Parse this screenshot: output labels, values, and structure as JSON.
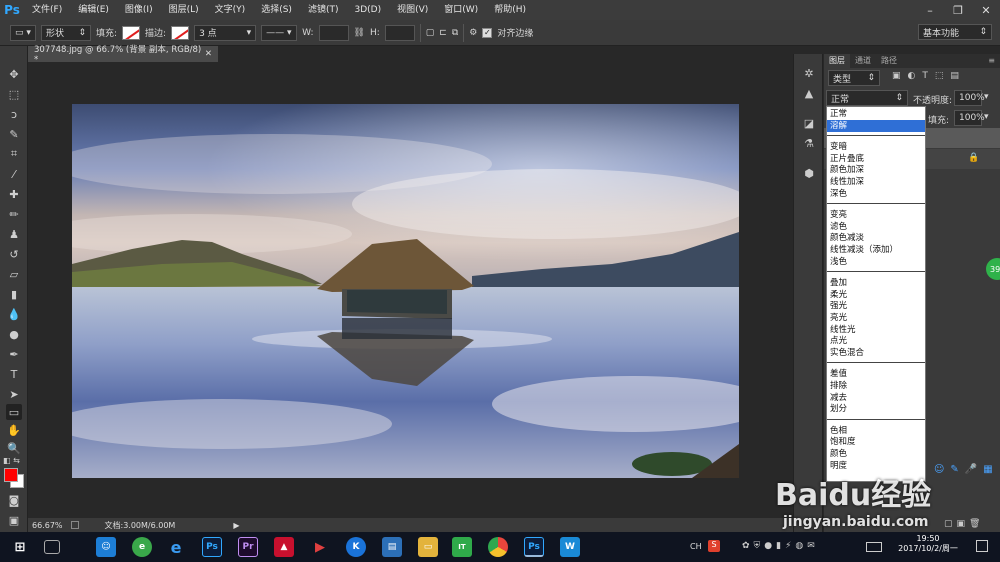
{
  "app": {
    "logo": "Ps"
  },
  "menu": [
    "文件(F)",
    "编辑(E)",
    "图像(I)",
    "图层(L)",
    "文字(Y)",
    "选择(S)",
    "滤镜(T)",
    "3D(D)",
    "视图(V)",
    "窗口(W)",
    "帮助(H)"
  ],
  "options": {
    "shape_mode": "形状",
    "fill_label": "填充:",
    "stroke_label": "描边:",
    "stroke_size": "3 点",
    "w_label": "W:",
    "h_label": "H:",
    "align_edges": "对齐边缘",
    "workspace": "基本功能"
  },
  "document": {
    "tab_title": "307748.jpg @ 66.7% (背景 副本, RGB/8) *",
    "zoom": "66.67%",
    "doc_size": "文档:3.00M/6.00M"
  },
  "layers_panel": {
    "tabs": [
      "图层",
      "通道",
      "路径"
    ],
    "filter_kind": "类型",
    "blend_mode": "正常",
    "opacity_label": "不透明度:",
    "opacity_value": "100%",
    "fill_label": "填充:",
    "fill_value": "100%"
  },
  "blend_modes": [
    [
      "正常",
      "溶解"
    ],
    [
      "变暗",
      "正片叠底",
      "颜色加深",
      "线性加深",
      "深色"
    ],
    [
      "变亮",
      "滤色",
      "颜色减淡",
      "线性减淡（添加）",
      "浅色"
    ],
    [
      "叠加",
      "柔光",
      "强光",
      "亮光",
      "线性光",
      "点光",
      "实色混合"
    ],
    [
      "差值",
      "排除",
      "减去",
      "划分"
    ],
    [
      "色相",
      "饱和度",
      "颜色",
      "明度"
    ]
  ],
  "blend_selected": "溶解",
  "side_badge": "39",
  "taskbar": {
    "time": "19:50",
    "date": "2017/10/2/周一",
    "ime": "CH"
  },
  "watermark": {
    "brand": "Baidu经验",
    "url": "jingyan.baidu.com"
  },
  "colors": {
    "foreground": "#ff0000",
    "background": "#ffffff",
    "accent": "#2f6fd6"
  }
}
